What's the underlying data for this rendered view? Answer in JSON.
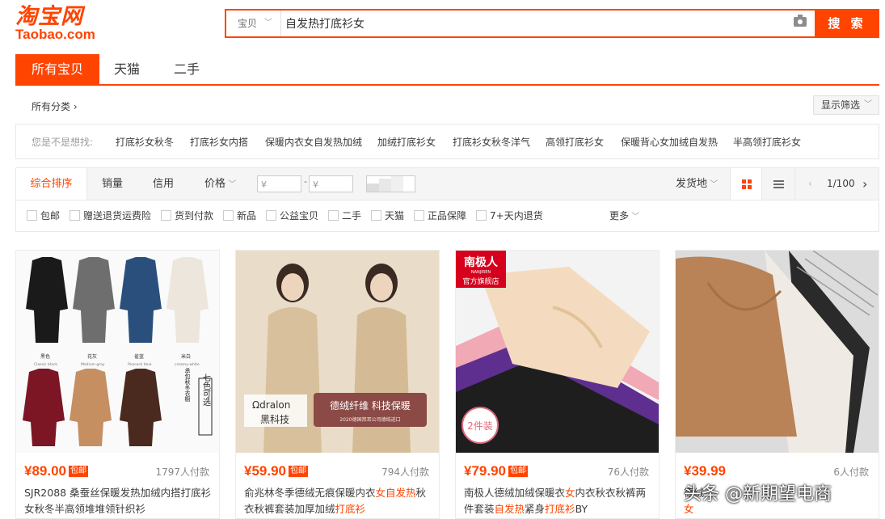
{
  "brand": {
    "name_cn": "淘宝网",
    "name_en": "Taobao.com",
    "color": "#ff4400"
  },
  "search": {
    "category": "宝贝",
    "query": "自发热打底衫女",
    "button": "搜 索"
  },
  "tabs": [
    "所有宝贝",
    "天猫",
    "二手"
  ],
  "category": {
    "label": "所有分类 ›",
    "filter_button": "显示筛选"
  },
  "suggest": {
    "label": "您是不是想找:",
    "items": [
      "打底衫女秋冬",
      "打底衫女内搭",
      "保暖内衣女自发热加绒",
      "加绒打底衫女",
      "打底衫女秋冬洋气",
      "高领打底衫女",
      "保暖背心女加绒自发热",
      "半高领打底衫女"
    ]
  },
  "sort": {
    "items": [
      "综合排序",
      "销量",
      "信用",
      "价格"
    ],
    "price_min": "¥",
    "price_max": "¥",
    "ship_from": "发货地",
    "pager": "1/100"
  },
  "filters": [
    "包邮",
    "赠送退货运费险",
    "货到付款",
    "新品",
    "公益宝贝",
    "二手",
    "天猫",
    "正品保障",
    "7+天内退货"
  ],
  "more": "更多",
  "products": [
    {
      "price": "¥89.00",
      "badge": "包邮",
      "sales": "1797人付款",
      "title": "SJR2088 桑蚕丝保暖发热加绒内搭打底衫女秋冬半高领堆堆领针织衫"
    },
    {
      "price": "¥59.90",
      "badge": "包邮",
      "sales": "794人付款",
      "title_parts": [
        "俞兆林冬季德绒无痕保暖内衣",
        "女自发热",
        "秋衣秋裤套装加厚加绒",
        "打底衫"
      ]
    },
    {
      "price": "¥79.90",
      "badge": "包邮",
      "sales": "76人付款",
      "title_parts": [
        "南极人德绒加绒保暖衣",
        "女",
        "内衣秋衣秋裤两件套装",
        "自发热",
        "紧身",
        "打底衫",
        "BY"
      ]
    },
    {
      "price": "¥39.99",
      "badge": "",
      "sales": "6人付款",
      "title_parts": [
        "德绒",
        "女"
      ]
    }
  ],
  "images": {
    "p1_colors": [
      "黑色",
      "花灰",
      "雀蓝",
      "米白"
    ],
    "p1_colors_en": [
      "Classic black",
      "Medium gray",
      "Peacock blue",
      "creamy-white"
    ],
    "p1_side": "七色可选",
    "p1_side2": "承包秋冬衣橱",
    "p2_brand": "dralon",
    "p2_brand2": "黑科技",
    "p2_banner": "德绒纤维  科技保暖",
    "p2_banner_sub": "2020德国拜耳公司德绒进口",
    "p3_brand": "南极人",
    "p3_brand_en": "NANJIREN",
    "p3_store": "官方旗舰店",
    "p3_badge": "2件装"
  },
  "watermark": "头条 @新期望电商"
}
